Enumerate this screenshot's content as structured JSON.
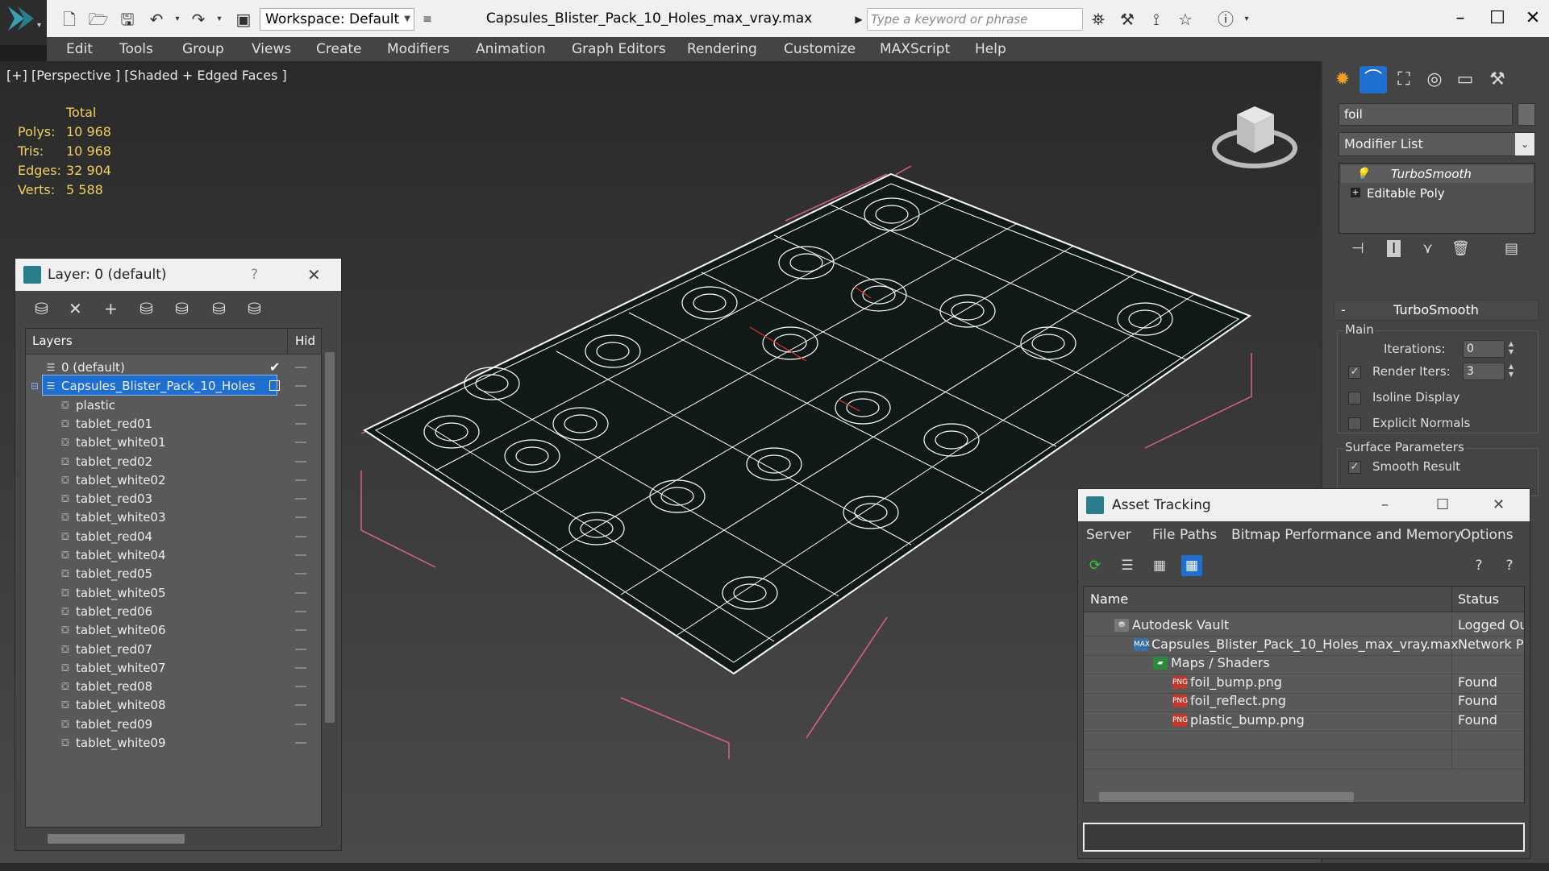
{
  "window": {
    "title": "Capsules_Blister_Pack_10_Holes_max_vray.max",
    "workspace": "Workspace: Default",
    "search_placeholder": "Type a keyword or phrase"
  },
  "menu": [
    "Edit",
    "Tools",
    "Group",
    "Views",
    "Create",
    "Modifiers",
    "Animation",
    "Graph Editors",
    "Rendering",
    "Customize",
    "MAXScript",
    "Help"
  ],
  "viewport": {
    "label": "[+] [Perspective ] [Shaded + Edged Faces ]",
    "stats": {
      "header": "Total",
      "rows": [
        {
          "key": "Polys:",
          "value": "10 968"
        },
        {
          "key": "Tris:",
          "value": "10 968"
        },
        {
          "key": "Edges:",
          "value": "32 904"
        },
        {
          "key": "Verts:",
          "value": "5 588"
        }
      ]
    }
  },
  "command_panel": {
    "object_name": "foil",
    "modifier_list": "Modifier List",
    "stack": [
      "TurboSmooth",
      "Editable Poly"
    ],
    "rollout_title": "TurboSmooth",
    "main_group": "Main",
    "iterations_label": "Iterations:",
    "iterations_value": "0",
    "render_iters_label": "Render Iters:",
    "render_iters_value": "3",
    "isoline_label": "Isoline Display",
    "explicit_label": "Explicit Normals",
    "surface_group": "Surface Parameters",
    "smooth_label": "Smooth Result"
  },
  "layer_dialog": {
    "title": "Layer: 0 (default)",
    "help": "?",
    "col_layers": "Layers",
    "col_hide": "Hid",
    "rows": [
      {
        "label": "0 (default)",
        "level": 0,
        "type": "layer"
      },
      {
        "label": "Capsules_Blister_Pack_10_Holes",
        "level": 0,
        "type": "layer",
        "selected": true
      },
      {
        "label": "plastic",
        "level": 1,
        "type": "object"
      },
      {
        "label": "tablet_red01",
        "level": 1,
        "type": "object"
      },
      {
        "label": "tablet_white01",
        "level": 1,
        "type": "object"
      },
      {
        "label": "tablet_red02",
        "level": 1,
        "type": "object"
      },
      {
        "label": "tablet_white02",
        "level": 1,
        "type": "object"
      },
      {
        "label": "tablet_red03",
        "level": 1,
        "type": "object"
      },
      {
        "label": "tablet_white03",
        "level": 1,
        "type": "object"
      },
      {
        "label": "tablet_red04",
        "level": 1,
        "type": "object"
      },
      {
        "label": "tablet_white04",
        "level": 1,
        "type": "object"
      },
      {
        "label": "tablet_red05",
        "level": 1,
        "type": "object"
      },
      {
        "label": "tablet_white05",
        "level": 1,
        "type": "object"
      },
      {
        "label": "tablet_red06",
        "level": 1,
        "type": "object"
      },
      {
        "label": "tablet_white06",
        "level": 1,
        "type": "object"
      },
      {
        "label": "tablet_red07",
        "level": 1,
        "type": "object"
      },
      {
        "label": "tablet_white07",
        "level": 1,
        "type": "object"
      },
      {
        "label": "tablet_red08",
        "level": 1,
        "type": "object"
      },
      {
        "label": "tablet_white08",
        "level": 1,
        "type": "object"
      },
      {
        "label": "tablet_red09",
        "level": 1,
        "type": "object"
      },
      {
        "label": "tablet_white09",
        "level": 1,
        "type": "object"
      }
    ]
  },
  "asset_dialog": {
    "title": "Asset Tracking",
    "menu": [
      "Server",
      "File",
      "Paths",
      "Bitmap Performance and Memory",
      "Options"
    ],
    "col_name": "Name",
    "col_status": "Status",
    "rows": [
      {
        "name": "Autodesk Vault",
        "status": "Logged Out",
        "level": 0,
        "icon": "vault"
      },
      {
        "name": "Capsules_Blister_Pack_10_Holes_max_vray.max",
        "status": "Network Path",
        "level": 1,
        "icon": "max"
      },
      {
        "name": "Maps / Shaders",
        "status": "",
        "level": 2,
        "icon": "maps"
      },
      {
        "name": "foil_bump.png",
        "status": "Found",
        "level": 3,
        "icon": "png"
      },
      {
        "name": "foil_reflect.png",
        "status": "Found",
        "level": 3,
        "icon": "png"
      },
      {
        "name": "plastic_bump.png",
        "status": "Found",
        "level": 3,
        "icon": "png"
      }
    ]
  },
  "colors": {
    "accent_blue": "#1f6fd1",
    "stats_yellow": "#f0d060",
    "wire": "#ffffff",
    "bbox": "#e06080",
    "mesh_fill": "#0f1a18"
  }
}
